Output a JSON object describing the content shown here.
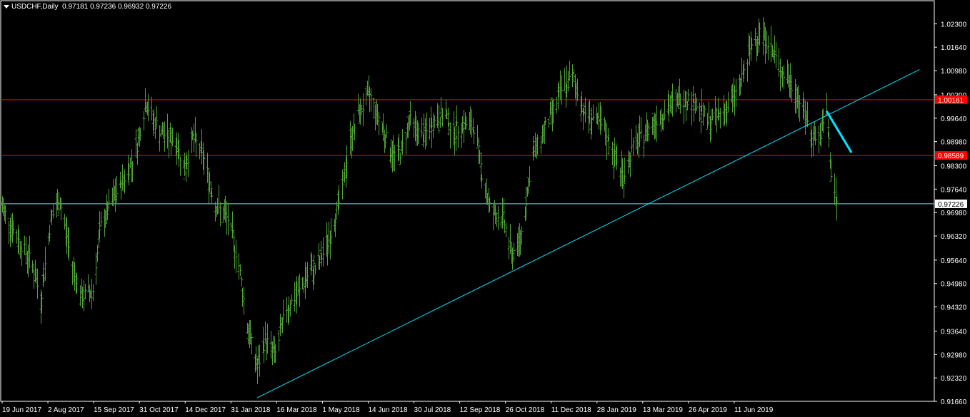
{
  "header": {
    "symbol": "USDCHF,Daily",
    "open": "0.97181",
    "high": "0.97236",
    "low": "0.96932",
    "close": "0.97226"
  },
  "colors": {
    "background": "#000000",
    "bars": "#4f9e36",
    "grid_frame": "#ffffff",
    "horizontal_level": "#ff0000",
    "price_line": "#87ceeb",
    "trendline": "#00e5ff",
    "arrow": "#00e5ff",
    "badge_red": "#ff0000"
  },
  "chart_data": {
    "type": "ohlc",
    "y_ticks": [
      "1.02300",
      "1.01640",
      "1.00980",
      "1.00300",
      "0.99640",
      "0.98980",
      "0.98300",
      "0.97640",
      "0.96980",
      "0.96320",
      "0.95640",
      "0.94980",
      "0.94320",
      "0.93640",
      "0.92980",
      "0.92320",
      "0.91660"
    ],
    "ylim": [
      0.9166,
      1.0295
    ],
    "x_ticks": [
      "19 Jun 2017",
      "2 Aug 2017",
      "15 Sep 2017",
      "31 Oct 2017",
      "14 Dec 2017",
      "31 Jan 2018",
      "16 Mar 2018",
      "1 May 2018",
      "14 Jun 2018",
      "30 Jul 2018",
      "12 Sep 2018",
      "26 Oct 2018",
      "11 Dec 2018",
      "28 Jan 2019",
      "13 Mar 2019",
      "26 Apr 2019",
      "11 Jun 2019"
    ],
    "xlim": [
      "2017-06-19",
      "2019-09-20"
    ],
    "series": [
      {
        "values": [
          [
            "2017-06-19",
            0.972
          ],
          [
            "2017-07-03",
            0.963
          ],
          [
            "2017-07-17",
            0.955
          ],
          [
            "2017-07-24",
            0.945
          ],
          [
            "2017-08-02",
            0.968
          ],
          [
            "2017-08-10",
            0.973
          ],
          [
            "2017-08-21",
            0.955
          ],
          [
            "2017-08-29",
            0.946
          ],
          [
            "2017-09-08",
            0.948
          ],
          [
            "2017-09-15",
            0.966
          ],
          [
            "2017-09-25",
            0.973
          ],
          [
            "2017-10-05",
            0.979
          ],
          [
            "2017-10-15",
            0.986
          ],
          [
            "2017-10-25",
            1.001
          ],
          [
            "2017-10-31",
            0.996
          ],
          [
            "2017-11-08",
            0.992
          ],
          [
            "2017-11-20",
            0.99
          ],
          [
            "2017-11-28",
            0.982
          ],
          [
            "2017-12-05",
            0.991
          ],
          [
            "2017-12-14",
            0.986
          ],
          [
            "2017-12-25",
            0.972
          ],
          [
            "2018-01-05",
            0.968
          ],
          [
            "2018-01-15",
            0.955
          ],
          [
            "2018-01-22",
            0.938
          ],
          [
            "2018-01-31",
            0.926
          ],
          [
            "2018-02-07",
            0.934
          ],
          [
            "2018-02-16",
            0.93
          ],
          [
            "2018-02-26",
            0.943
          ],
          [
            "2018-03-08",
            0.947
          ],
          [
            "2018-03-16",
            0.952
          ],
          [
            "2018-03-26",
            0.955
          ],
          [
            "2018-04-05",
            0.963
          ],
          [
            "2018-04-15",
            0.975
          ],
          [
            "2018-04-23",
            0.99
          ],
          [
            "2018-05-01",
            0.998
          ],
          [
            "2018-05-10",
            1.003
          ],
          [
            "2018-05-20",
            0.995
          ],
          [
            "2018-05-30",
            0.986
          ],
          [
            "2018-06-07",
            0.987
          ],
          [
            "2018-06-14",
            0.996
          ],
          [
            "2018-06-25",
            0.991
          ],
          [
            "2018-07-05",
            0.995
          ],
          [
            "2018-07-15",
            0.998
          ],
          [
            "2018-07-23",
            0.992
          ],
          [
            "2018-07-30",
            0.995
          ],
          [
            "2018-08-10",
            0.994
          ],
          [
            "2018-08-17",
            0.981
          ],
          [
            "2018-08-25",
            0.97
          ],
          [
            "2018-09-05",
            0.968
          ],
          [
            "2018-09-12",
            0.958
          ],
          [
            "2018-09-20",
            0.962
          ],
          [
            "2018-09-30",
            0.985
          ],
          [
            "2018-10-08",
            0.991
          ],
          [
            "2018-10-18",
            0.998
          ],
          [
            "2018-10-26",
            1.004
          ],
          [
            "2018-11-05",
            1.008
          ],
          [
            "2018-11-15",
            0.998
          ],
          [
            "2018-11-25",
            0.996
          ],
          [
            "2018-12-03",
            0.993
          ],
          [
            "2018-12-11",
            0.986
          ],
          [
            "2018-12-20",
            0.98
          ],
          [
            "2018-12-28",
            0.988
          ],
          [
            "2019-01-10",
            0.993
          ],
          [
            "2019-01-20",
            0.997
          ],
          [
            "2019-01-28",
            0.999
          ],
          [
            "2019-02-07",
            1.002
          ],
          [
            "2019-02-17",
            1.002
          ],
          [
            "2019-02-25",
            0.999
          ],
          [
            "2019-03-05",
            0.995
          ],
          [
            "2019-03-13",
            0.997
          ],
          [
            "2019-03-23",
            1.0
          ],
          [
            "2019-04-02",
            1.006
          ],
          [
            "2019-04-12",
            1.017
          ],
          [
            "2019-04-19",
            1.021
          ],
          [
            "2019-04-26",
            1.018
          ],
          [
            "2019-05-06",
            1.011
          ],
          [
            "2019-05-16",
            1.006
          ],
          [
            "2019-05-26",
            1.0
          ],
          [
            "2019-06-03",
            0.992
          ],
          [
            "2019-06-11",
            0.991
          ],
          [
            "2019-06-17",
            0.998
          ],
          [
            "2019-06-21",
            0.981
          ],
          [
            "2019-06-26",
            0.972
          ]
        ]
      }
    ],
    "horizontal_levels": [
      {
        "value": 1.00161,
        "label": "1.00161",
        "kind": "red"
      },
      {
        "value": 0.98589,
        "label": "0.98589",
        "kind": "red"
      },
      {
        "value": 0.97226,
        "label": "0.97226",
        "kind": "price"
      }
    ],
    "trendline": {
      "from": [
        "2018-01-31",
        0.9176
      ],
      "to": [
        "2019-09-07",
        1.0101
      ]
    },
    "arrow": {
      "from": [
        "2019-06-17",
        0.9984
      ],
      "to": [
        "2019-07-09",
        0.9867
      ]
    }
  }
}
